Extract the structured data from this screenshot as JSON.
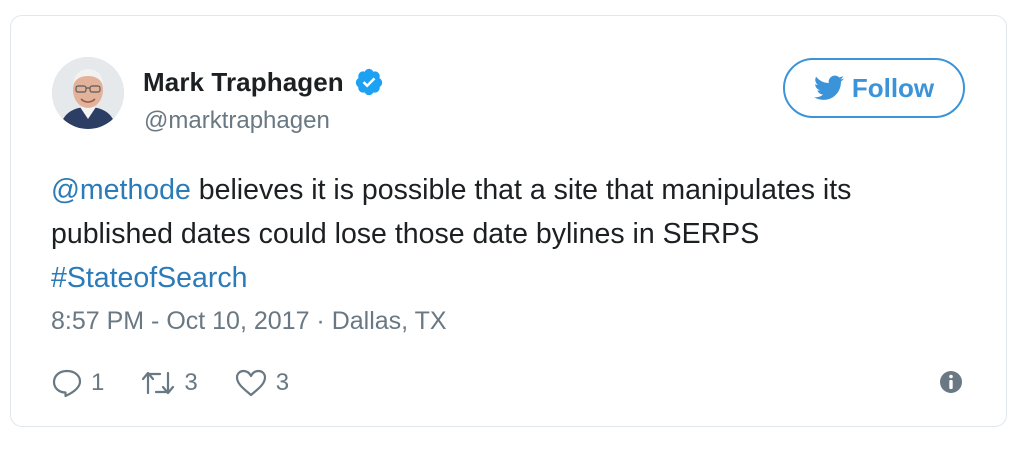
{
  "tweet": {
    "author": {
      "name": "Mark Traphagen",
      "handle": "@marktraphagen",
      "verified_icon": "verified-badge-icon",
      "avatar": "avatar"
    },
    "follow": {
      "icon": "twitter-bird-icon",
      "label": "Follow"
    },
    "text": {
      "mention": "@methode",
      "body": " believes it is possible that a site that manipulates its published dates could lose those date bylines in SERPS",
      "hashtag": "#StateofSearch"
    },
    "meta": {
      "time": "8:57 PM - Oct 10, 2017",
      "separator": " · ",
      "location": "Dallas, TX"
    },
    "actions": {
      "reply": {
        "icon": "reply-icon",
        "count": "1"
      },
      "retweet": {
        "icon": "retweet-icon",
        "count": "3"
      },
      "like": {
        "icon": "heart-icon",
        "count": "3"
      },
      "info": {
        "icon": "info-icon"
      }
    }
  },
  "colors": {
    "link": "#2b7bb9",
    "follow_blue": "#3b94d9",
    "muted": "#697882",
    "verified": "#1da1f2",
    "text": "#1c2022",
    "border": "#e1e8ed"
  }
}
